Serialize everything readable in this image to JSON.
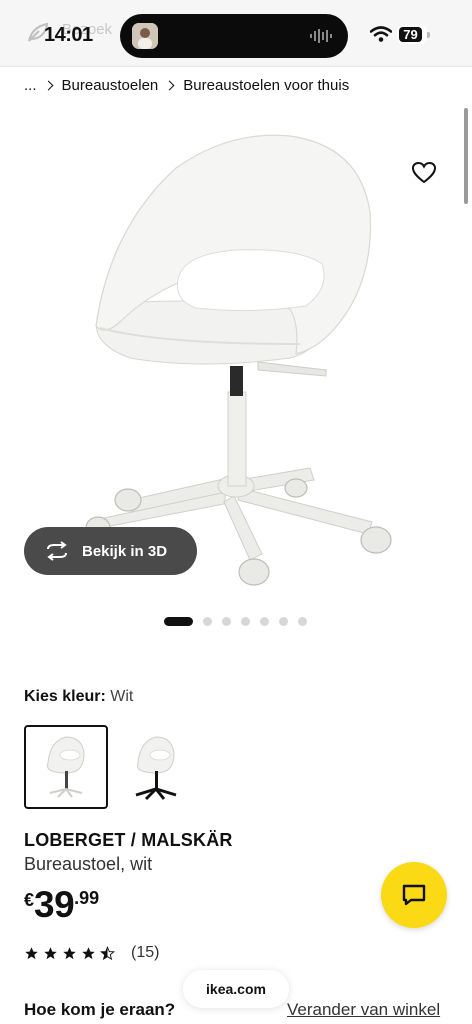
{
  "status_bar": {
    "time": "14:01",
    "ghost_text": "Bezoek",
    "battery": "79",
    "icons": [
      "leaf-icon",
      "wifi-icon",
      "battery-icon",
      "audio-wave-icon"
    ]
  },
  "breadcrumb": {
    "items": [
      "...",
      "Bureaustoelen",
      "Bureaustoelen voor thuis"
    ]
  },
  "gallery": {
    "view_3d_label": "Bekijk in 3D",
    "image_count": 7,
    "active_index": 0
  },
  "color_choice": {
    "label": "Kies kleur:",
    "value": "Wit",
    "options": [
      "white-chair",
      "black-base-chair"
    ],
    "selected": 0
  },
  "product": {
    "name": "LOBERGET / MALSKÄR",
    "description": "Bureaustoel, wit",
    "price_currency": "€",
    "price_integer": "39",
    "price_decimal": ".99",
    "rating": 4.5,
    "review_count": "(15)"
  },
  "browser": {
    "url": "ikea.com"
  },
  "footer": {
    "how_to_get_there": "Hoe kom je eraan?",
    "change_store": "Verander van winkel"
  },
  "colors": {
    "chat_button": "#fbd914",
    "btn_3d_bg": "#4a4a4a",
    "chair": "#f3f3f1"
  }
}
